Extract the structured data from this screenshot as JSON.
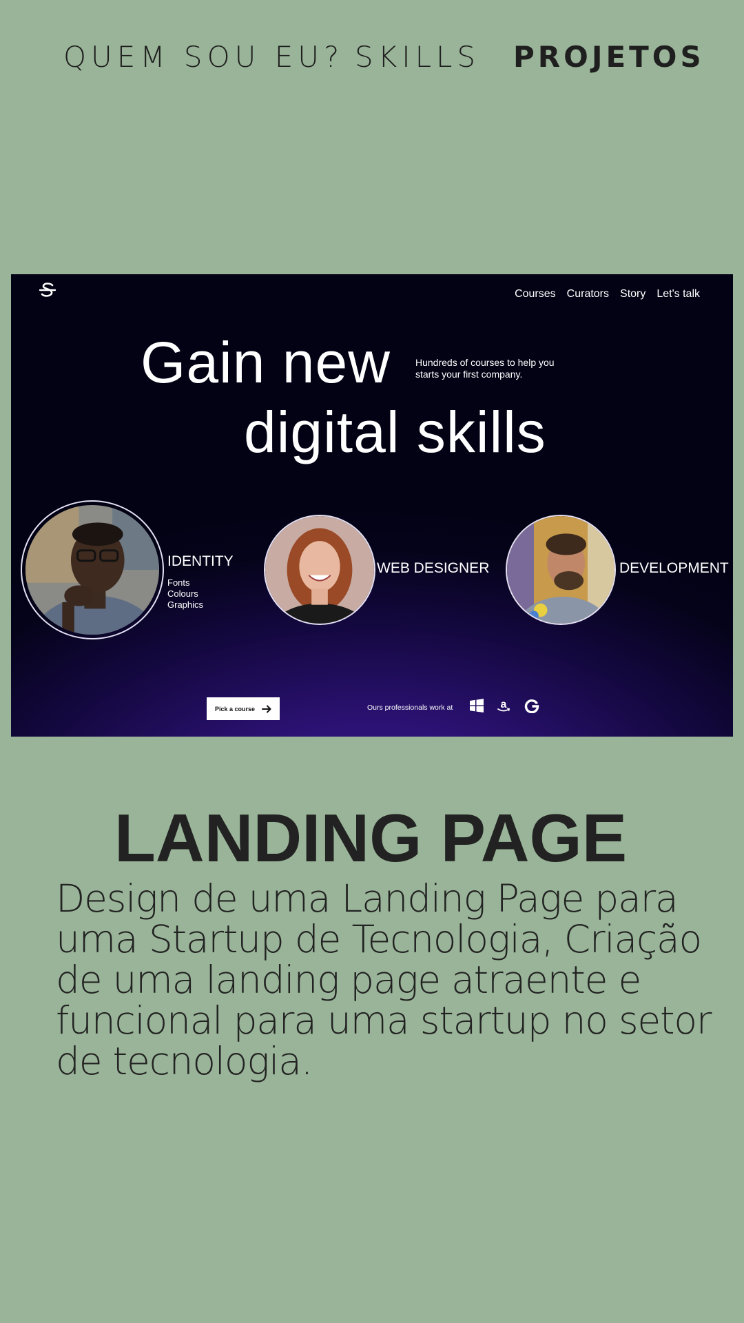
{
  "nav": {
    "items": [
      {
        "label": "QUEM SOU EU?",
        "active": false
      },
      {
        "label": "SKILLS",
        "active": false
      },
      {
        "label": "PROJETOS",
        "active": true
      }
    ]
  },
  "project": {
    "screenshot": {
      "nav_links": [
        "Courses",
        "Curators",
        "Story",
        "Let's talk"
      ],
      "hero_line1": "Gain new",
      "hero_line2": "digital skills",
      "hero_sub": "Hundreds of courses to help you starts your first company.",
      "categories": [
        {
          "label": "IDENTITY",
          "items": [
            "Fonts",
            "Colours",
            "Graphics"
          ]
        },
        {
          "label": "WEB DESIGNER"
        },
        {
          "label": "DEVELOPMENT"
        }
      ],
      "cta_label": "Pick a course",
      "pros_text": "Ours professionals work at",
      "brands": [
        "windows-icon",
        "amazon-icon",
        "google-icon"
      ],
      "background_color": "#05031a",
      "accent_color": "#3a1890"
    },
    "title": "LANDING PAGE",
    "description": "Design de uma Landing Page para uma Startup de Tecnologia, Criação de uma landing page atraente e funcional para uma startup no setor de tecnologia."
  }
}
